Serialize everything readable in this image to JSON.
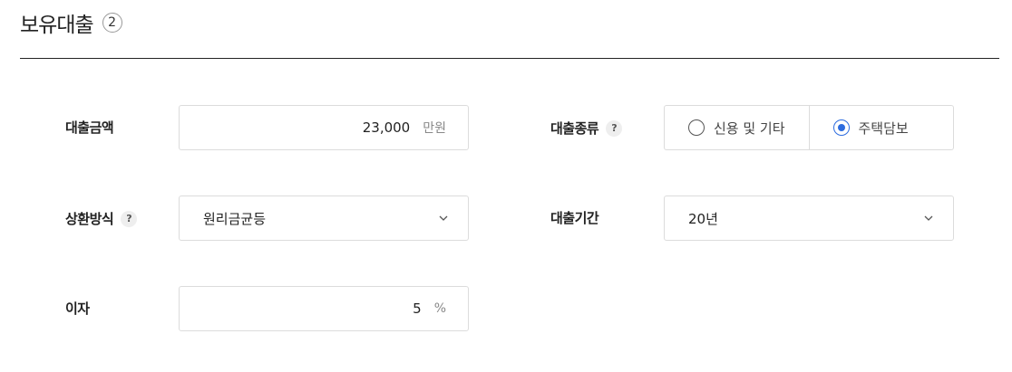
{
  "section": {
    "title": "보유대출",
    "count": "2"
  },
  "loan_amount": {
    "label": "대출금액",
    "value": "23,000",
    "unit": "만원"
  },
  "loan_type": {
    "label": "대출종류",
    "help": "?",
    "options": [
      "신용 및 기타",
      "주택담보"
    ],
    "selected": "주택담보"
  },
  "repayment": {
    "label": "상환방식",
    "help": "?",
    "value": "원리금균등"
  },
  "loan_period": {
    "label": "대출기간",
    "value": "20년"
  },
  "interest": {
    "label": "이자",
    "value": "5",
    "unit": "%"
  },
  "colors": {
    "accent": "#2d6cdf",
    "border": "#dcdcdc",
    "divider": "#222222"
  },
  "icons": {
    "dropdown": "chevron-down-icon",
    "help": "question-icon"
  }
}
